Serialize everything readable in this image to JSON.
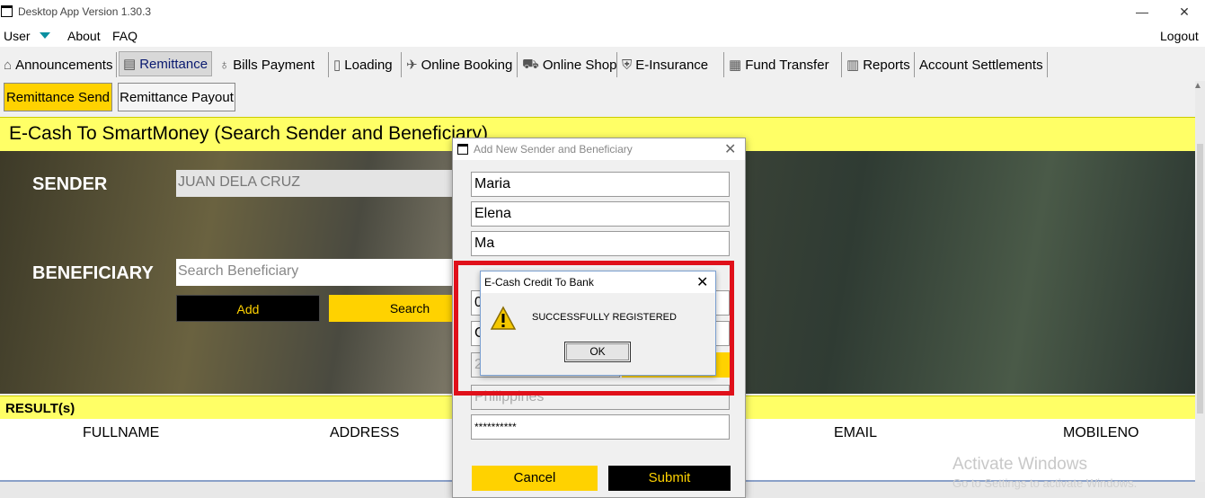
{
  "window": {
    "title": "Desktop App Version 1.30.3",
    "minimize": "—",
    "maximize": "☐",
    "close": "✕"
  },
  "menu": {
    "user": "User",
    "about": "About",
    "faq": "FAQ",
    "logout": "Logout"
  },
  "tabs": [
    {
      "label": "Announcements",
      "icon": "home-icon"
    },
    {
      "label": "Remittance",
      "icon": "remittance-icon"
    },
    {
      "label": "Bills Payment",
      "icon": "money-bag-icon"
    },
    {
      "label": "Loading",
      "icon": "phone-icon"
    },
    {
      "label": "Online Booking",
      "icon": "plane-icon"
    },
    {
      "label": "Online Shop",
      "icon": "cart-icon"
    },
    {
      "label": "E-Insurance",
      "icon": "insurance-icon"
    },
    {
      "label": "Fund Transfer",
      "icon": "money-stack-icon"
    },
    {
      "label": "Reports",
      "icon": "report-icon"
    },
    {
      "label": "Account Settlements",
      "icon": ""
    }
  ],
  "subtabs": {
    "send": "Remittance Send",
    "payout": "Remittance Payout"
  },
  "banner": {
    "title": "E-Cash To SmartMoney (Search Sender and Beneficiary)"
  },
  "sender": {
    "label": "SENDER",
    "value": "JUAN DELA CRUZ"
  },
  "beneficiary": {
    "label": "BENEFICIARY",
    "placeholder": "Search Beneficiary",
    "add": "Add",
    "search": "Search"
  },
  "results": {
    "label": "RESULT(s)",
    "columns": [
      "FULLNAME",
      "ADDRESS",
      "EMAIL",
      "MOBILENO"
    ]
  },
  "dialog": {
    "title": "Add New Sender and Beneficiary",
    "fields": [
      "Maria",
      "Elena",
      "Ma",
      "0",
      "C",
      "2",
      "Philippines",
      "**********"
    ],
    "cancel": "Cancel",
    "submit": "Submit"
  },
  "message_box": {
    "title": "E-Cash Credit To Bank",
    "text": "SUCCESSFULLY REGISTERED",
    "ok": "OK"
  },
  "watermark": {
    "line1": "Activate Windows",
    "line2": "Go to Settings to activate Windows."
  }
}
